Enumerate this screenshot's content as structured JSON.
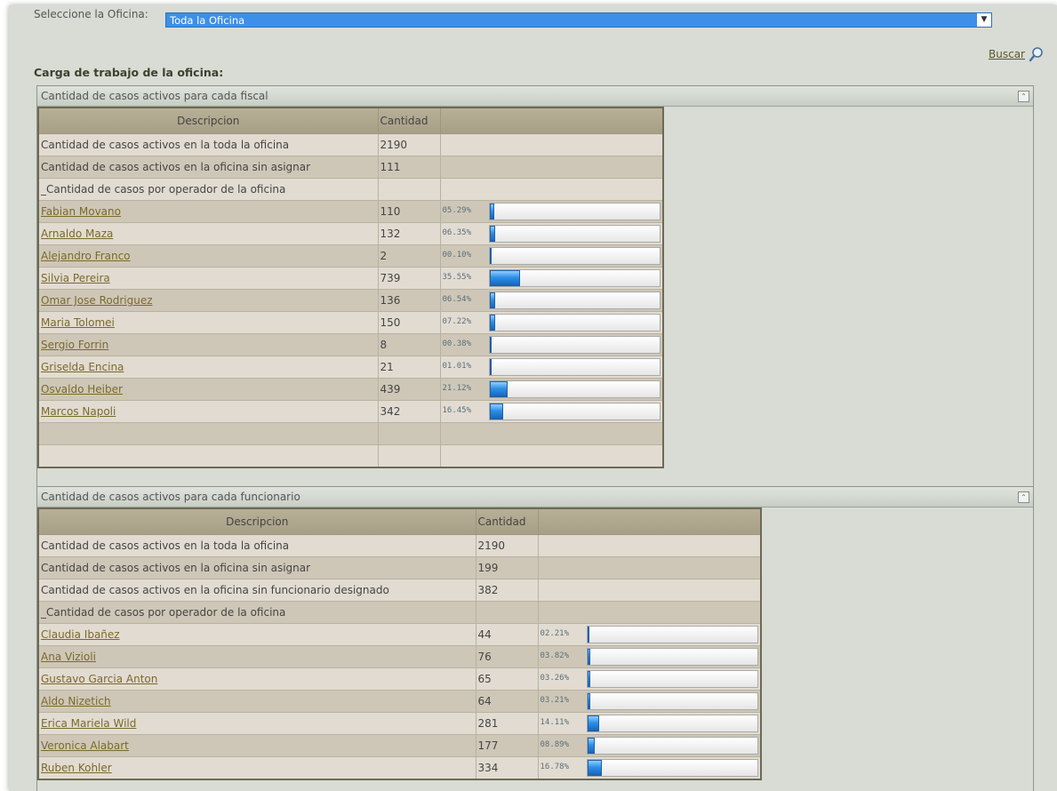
{
  "office": {
    "label": "Seleccione la Oficina:",
    "selected": "Toda la Oficina"
  },
  "buscar_label": "Buscar",
  "section_title": "Carga de trabajo de la oficina:",
  "panel1": {
    "title": "Cantidad de casos activos para cada fiscal",
    "headers": [
      "Descripcion",
      "Cantidad"
    ],
    "summary": [
      {
        "desc": "Cantidad de casos activos en la toda la oficina",
        "qty": "2190"
      },
      {
        "desc": "Cantidad de casos activos en la oficina sin asignar",
        "qty": "111"
      },
      {
        "desc": "_Cantidad de casos por operador de la oficina",
        "qty": ""
      }
    ],
    "operators": [
      {
        "name": "Fabian Movano",
        "qty": "110",
        "pct": "05.29%",
        "value": 5.29
      },
      {
        "name": "Arnaldo Maza",
        "qty": "132",
        "pct": "06.35%",
        "value": 6.35
      },
      {
        "name": "Alejandro Franco",
        "qty": "2",
        "pct": "00.10%",
        "value": 0.1
      },
      {
        "name": "Silvia Pereira",
        "qty": "739",
        "pct": "35.55%",
        "value": 35.55
      },
      {
        "name": "Omar Jose Rodriguez",
        "qty": "136",
        "pct": "06.54%",
        "value": 6.54
      },
      {
        "name": "Maria Tolomei",
        "qty": "150",
        "pct": "07.22%",
        "value": 7.22
      },
      {
        "name": "Sergio Forrin",
        "qty": "8",
        "pct": "00.38%",
        "value": 0.38
      },
      {
        "name": "Griselda Encina",
        "qty": "21",
        "pct": "01.01%",
        "value": 1.01
      },
      {
        "name": "Osvaldo Heiber",
        "qty": "439",
        "pct": "21.12%",
        "value": 21.12
      },
      {
        "name": "Marcos Napoli",
        "qty": "342",
        "pct": "16.45%",
        "value": 16.45
      }
    ]
  },
  "panel2": {
    "title": "Cantidad de casos activos para cada funcionario",
    "headers": [
      "Descripcion",
      "Cantidad"
    ],
    "summary": [
      {
        "desc": "Cantidad de casos activos en la toda la oficina",
        "qty": "2190"
      },
      {
        "desc": "Cantidad de casos activos en la oficina sin asignar",
        "qty": "199"
      },
      {
        "desc": "Cantidad de casos activos en la oficina sin funcionario designado",
        "qty": "382"
      },
      {
        "desc": "_Cantidad de casos por operador de la oficina",
        "qty": ""
      }
    ],
    "operators": [
      {
        "name": "Claudia Ibañez",
        "qty": "44",
        "pct": "02.21%",
        "value": 2.21
      },
      {
        "name": "Ana Vizioli",
        "qty": "76",
        "pct": "03.82%",
        "value": 3.82
      },
      {
        "name": "Gustavo Garcia Anton",
        "qty": "65",
        "pct": "03.26%",
        "value": 3.26
      },
      {
        "name": "Aldo Nizetich",
        "qty": "64",
        "pct": "03.21%",
        "value": 3.21
      },
      {
        "name": "Erica Mariela Wild",
        "qty": "281",
        "pct": "14.11%",
        "value": 14.11
      },
      {
        "name": "Veronica Alabart",
        "qty": "177",
        "pct": "08.89%",
        "value": 8.89
      },
      {
        "name": "Ruben Kohler",
        "qty": "334",
        "pct": "16.78%",
        "value": 16.78
      }
    ]
  }
}
